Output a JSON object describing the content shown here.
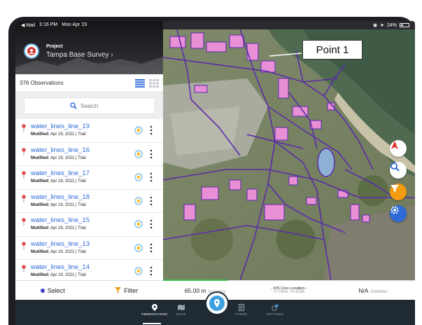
{
  "status_bar": {
    "back_app": "◀ Mail",
    "time": "3:16 PM",
    "date": "Mon Apr 19",
    "battery": "24%"
  },
  "project": {
    "label": "Project",
    "name": "Tampa Base Survey ›"
  },
  "observations": {
    "count_label": "376 Observations",
    "search_placeholder": "Search",
    "items": [
      {
        "name": "water_lines_line_19",
        "modified_label": "Modified:",
        "modified_value": "Apr 19, 2021 | Trial"
      },
      {
        "name": "water_lines_line_16",
        "modified_label": "Modified:",
        "modified_value": "Apr 19, 2021 | Trial"
      },
      {
        "name": "water_lines_line_17",
        "modified_label": "Modified:",
        "modified_value": "Apr 19, 2021 | Trial"
      },
      {
        "name": "water_lines_line_18",
        "modified_label": "Modified:",
        "modified_value": "Apr 19, 2021 | Trial"
      },
      {
        "name": "water_lines_line_15",
        "modified_label": "Modified:",
        "modified_value": "Apr 19, 2021 | Trial"
      },
      {
        "name": "water_lines_line_13",
        "modified_label": "Modified:",
        "modified_value": "Apr 19, 2021 | Trial"
      },
      {
        "name": "water_lines_line_14",
        "modified_label": "Modified:",
        "modified_value": "Apr 19, 2021 | Trial"
      }
    ]
  },
  "left_footer": {
    "select_label": "Select",
    "filter_label": "Filter"
  },
  "map": {
    "callout": "Point 1",
    "buttons": [
      "navigate-icon",
      "search-icon",
      "filter-icon",
      "settings-icon"
    ]
  },
  "map_footer": {
    "accuracy_value": "65.00 m",
    "accuracy_label": "Accuracy",
    "location_source": "- iOS Core Location -",
    "coordinates": "27.15836 -76.43286",
    "satellites_value": "N/A",
    "satellites_label": "Satellites"
  },
  "tabs": [
    {
      "label": "OBSERVATIONS",
      "icon": "pin-icon",
      "active": true
    },
    {
      "label": "MAPS",
      "icon": "map-icon",
      "active": false
    },
    {
      "label": "FORMS",
      "icon": "forms-icon",
      "active": false
    },
    {
      "label": "SETTINGS",
      "icon": "settings-icon",
      "active": false
    }
  ],
  "colors": {
    "accent_blue": "#2f6bd8",
    "pin_red": "#e05050",
    "filter_orange": "#f39c12",
    "nav_red": "#e53935",
    "polyline_purple": "#5b2ca8",
    "building_pink": "#e98fd6",
    "tabbar": "#1f2a33"
  }
}
